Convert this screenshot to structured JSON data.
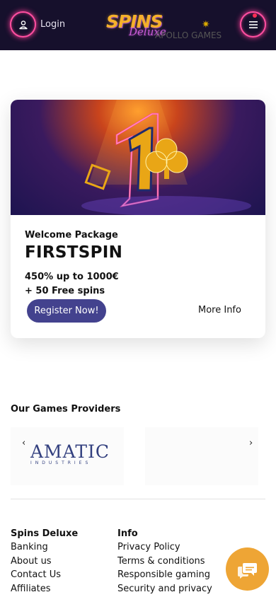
{
  "header": {
    "login_label": "Login",
    "logo_main": "SPINS",
    "logo_sub": "Deluxe"
  },
  "promo": {
    "banner_number": "1",
    "welcome_label": "Welcome Package",
    "code": "FIRSTSPIN",
    "offer_line_1": "450% up to 1000€",
    "offer_line_2": "+ 50 Free spins",
    "register_label": "Register Now!",
    "more_info_label": "More Info"
  },
  "providers": {
    "title": "Our Games Providers",
    "prev_arrow": "‹",
    "next_arrow": "›",
    "items": [
      {
        "name": "AMATIC",
        "sub": "INDUSTRIES"
      },
      {
        "name": "APOLLO GAMES"
      }
    ]
  },
  "footer": {
    "col1": {
      "heading": "Spins Deluxe",
      "links": [
        "Banking",
        "About us",
        "Contact Us",
        "Affiliates"
      ]
    },
    "col2": {
      "heading": "Info",
      "links": [
        "Privacy Policy",
        "Terms & conditions",
        "Responsible gaming",
        "Security and privacy"
      ]
    }
  },
  "colors": {
    "header_bg": "#16102c",
    "neon_pink": "#ff4fa0",
    "register_btn": "#43428e",
    "chat_btn": "#eea535",
    "provider_blue": "#33407f"
  },
  "icons": {
    "login": "user-icon",
    "menu": "hamburger-icon",
    "chat": "chat-bubble-icon"
  }
}
